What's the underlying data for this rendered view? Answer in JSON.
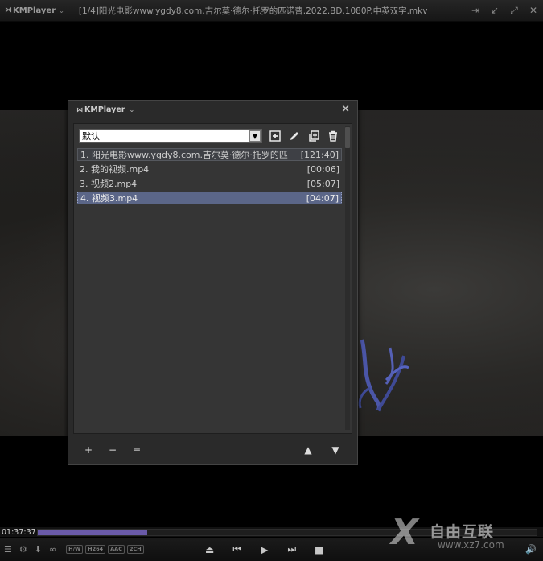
{
  "window": {
    "app_name": "KMPlayer",
    "title": "[1/4]阳光电影www.ygdy8.com.吉尔莫·德尔·托罗的匹诺曹.2022.BD.1080P.中英双字.mkv",
    "icons": [
      "pin-icon",
      "minimize-icon",
      "maximize-icon",
      "close-icon"
    ]
  },
  "playlist": {
    "header_title": "KMPlayer",
    "close_label": "×",
    "list_name": "默认",
    "toolbar_icons": [
      "add-list-icon",
      "rename-icon",
      "copy-list-icon",
      "delete-list-icon"
    ],
    "items": [
      {
        "name": "1. 阳光电影www.ygdy8.com.吉尔莫·德尔·托罗的匹",
        "duration": "[121:40]",
        "state": "playing"
      },
      {
        "name": "2. 我的视频.mp4",
        "duration": "[00:06]",
        "state": "normal"
      },
      {
        "name": "3. 视频2.mp4",
        "duration": "[05:07]",
        "state": "normal"
      },
      {
        "name": "4. 视频3.mp4",
        "duration": "[04:07]",
        "state": "selected"
      }
    ],
    "footer": {
      "add": "+",
      "remove": "−",
      "menu": "≡",
      "up": "▲",
      "down": "▼"
    }
  },
  "playback": {
    "elapsed": "01:37:37",
    "progress_fraction": 0.22,
    "badges": [
      "H/W",
      "H264",
      "AAC",
      "2CH"
    ]
  },
  "watermark": {
    "brand": "自由互联",
    "url": "www.xz7.com"
  },
  "colors": {
    "progress": "#6a5aa8",
    "selected_row": "#5b6688"
  }
}
